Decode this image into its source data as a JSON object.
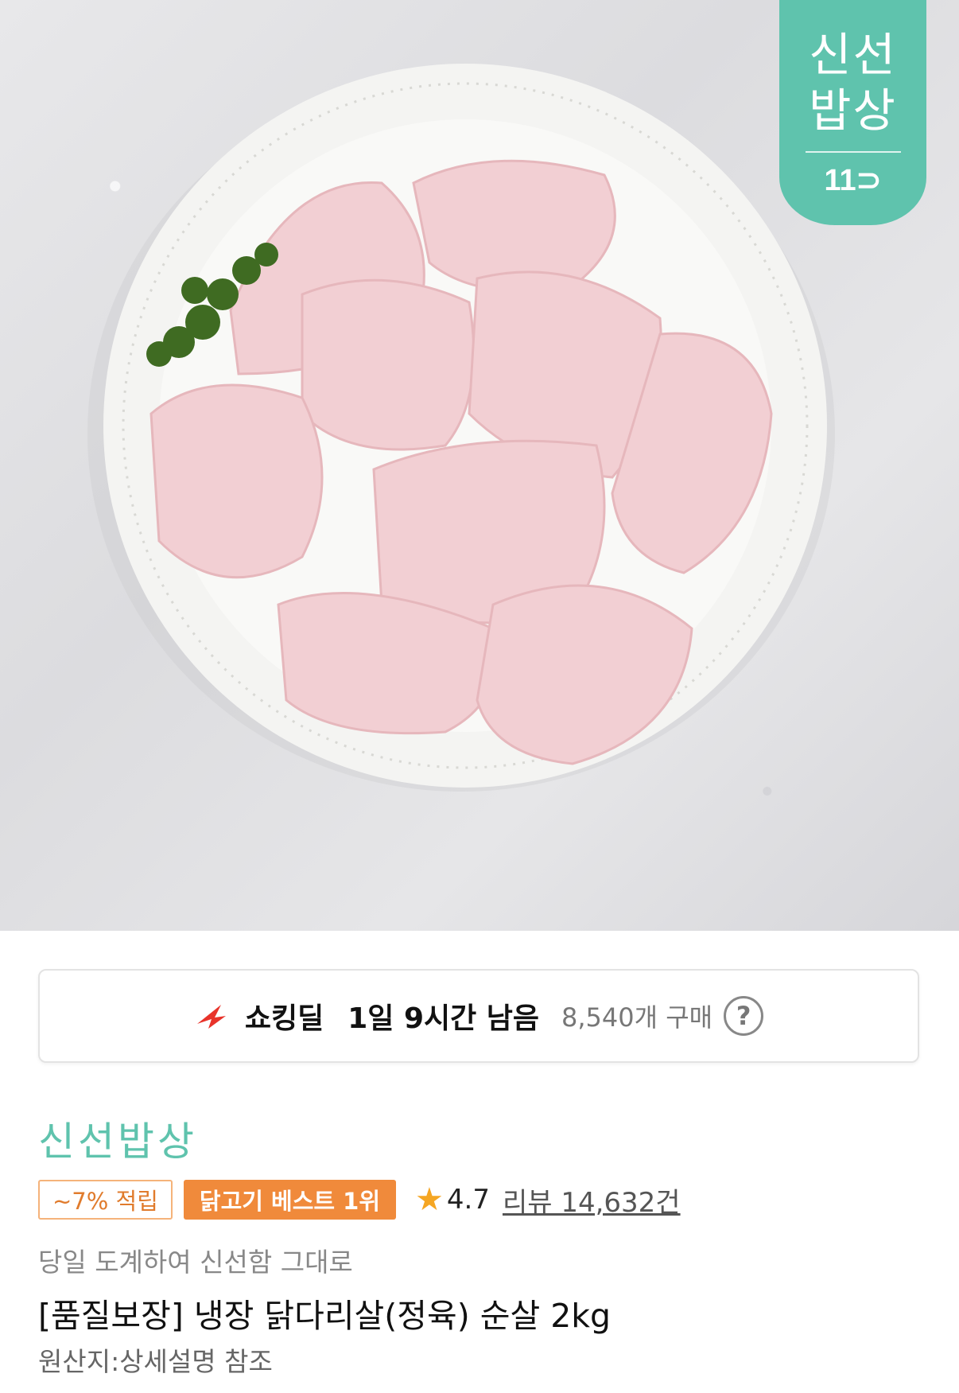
{
  "brand_badge": {
    "line1": "신선",
    "line2": "밥상",
    "logo": "11⊃"
  },
  "deal": {
    "label": "쇼킹딜",
    "timer": "1일 9시간 남음",
    "count": "8,540개 구매",
    "help": "?",
    "icon": "shocking-deal-bolt-icon",
    "accent": "#e8332a"
  },
  "seller_name": "신선밥상",
  "badges": {
    "points": "~7% 적립",
    "best": "닭고기 베스트 1위"
  },
  "rating": {
    "star": "★",
    "score": "4.7",
    "reviews": "리뷰 14,632건"
  },
  "product": {
    "subtitle": "당일 도계하여 신선함 그대로",
    "title": "[품질보장] 냉장 닭다리살(정육) 순살 2kg",
    "origin": "원산지:상세설명 참조"
  },
  "colors": {
    "brand": "#5fc3ad",
    "best_tag": "#f08a3b",
    "star": "#f5a623"
  }
}
